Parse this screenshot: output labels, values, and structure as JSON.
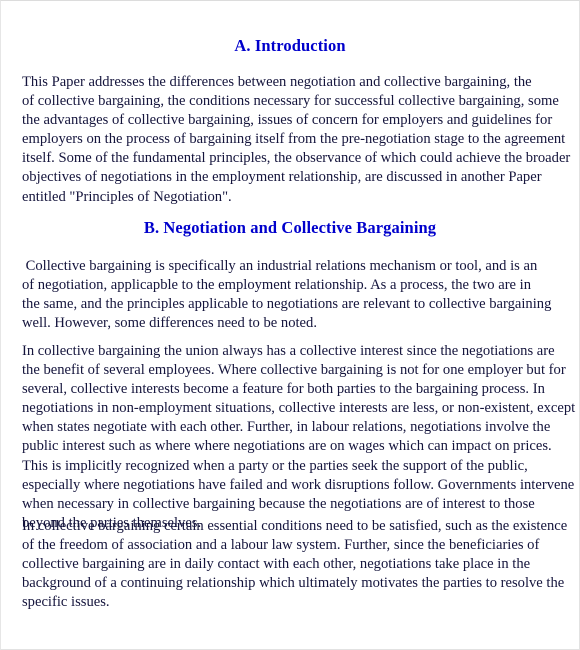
{
  "document": {
    "page_background": "#ffffff",
    "heading_color": "#0000cc",
    "body_text_color": "#14143c",
    "border_color": "#e2e2e2"
  },
  "sections": {
    "heading_a": "A. Introduction",
    "heading_b": "B. Negotiation and Collective Bargaining"
  },
  "paragraphs": {
    "p1": {
      "lines": [
        "This Paper addresses the differences between negotiation and collective bargaining, the",
        "of collective bargaining, the conditions necessary for successful collective bargaining, some",
        "the advantages of collective bargaining, issues of concern for employers and guidelines for",
        "employers on the process of bargaining itself from the pre-negotiation stage to the agreement",
        "itself. Some of the fundamental principles, the observance of which could achieve the broader",
        "objectives of negotiations in the employment relationship, are discussed in another Paper",
        "entitled \"Principles of Negotiation\"."
      ]
    },
    "p2": {
      "lines": [
        " Collective bargaining is specifically an industrial relations mechanism or tool, and is an",
        "of negotiation, applicapble to the employment relationship. As a process, the two are in",
        "the same, and the principles applicable to negotiations are relevant to collective bargaining",
        "well. However, some differences need to be noted."
      ]
    },
    "p3": {
      "lines": [
        "In collective bargaining the union always has a collective interest since the negotiations are",
        "the benefit of several employees. Where collective bargaining is not for one employer but for",
        "several, collective interests become a feature for both parties to the bargaining process. In",
        "negotiations in non-employment situations, collective interests are less, or non-existent, except",
        "when states negotiate with each other. Further, in labour relations, negotiations involve the",
        "public interest such as where where negotiations are on wages which can impact on prices.",
        "This is implicitly recognized when a party or the parties seek the support of the public,",
        "especially where negotiations have failed and work disruptions follow. Governments intervene",
        "when necessary in collective bargaining because the negotiations are of interest to those",
        "beyond the parties themselves."
      ]
    },
    "p4": {
      "lines": [
        "In collective bargaining certain essential conditions need to be satisfied, such as the existence",
        "of the freedom of association and a labour law system. Further, since the beneficiaries of",
        "collective bargaining are in daily contact with each other, negotiations take place in the",
        "background of a continuing relationship which ultimately motivates the parties to resolve the",
        "specific issues."
      ]
    }
  }
}
